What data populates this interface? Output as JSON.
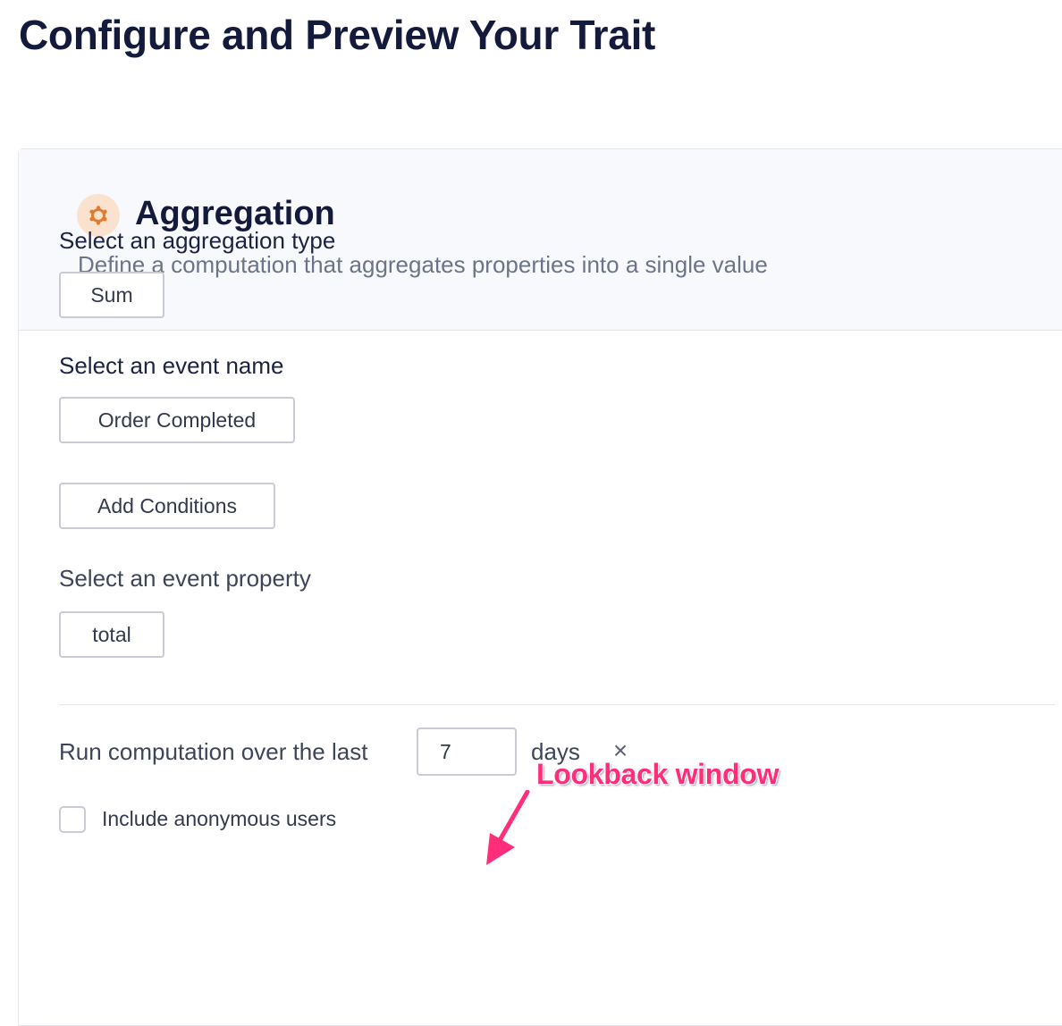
{
  "page": {
    "title": "Configure and Preview Your Trait"
  },
  "card": {
    "title": "Aggregation",
    "subtitle": "Define a computation that aggregates properties into a single value",
    "icon": "aggregation-icon",
    "accent_color": "#e07b2f",
    "icon_bg_color": "#fbe2cf"
  },
  "aggregation_type": {
    "label": "Select an aggregation type",
    "value": "Sum"
  },
  "event_name": {
    "label": "Select an event name",
    "value": "Order Completed"
  },
  "conditions": {
    "button_label": "Add Conditions"
  },
  "event_property": {
    "label": "Select an event property",
    "value": "total"
  },
  "lookback": {
    "prefix": "Run computation over the last",
    "value": "7",
    "suffix": "days",
    "clear_symbol": "×"
  },
  "anonymous": {
    "label": "Include anonymous users",
    "checked": false
  },
  "annotation": {
    "text": "Lookback window",
    "color": "#ff2d7a"
  }
}
